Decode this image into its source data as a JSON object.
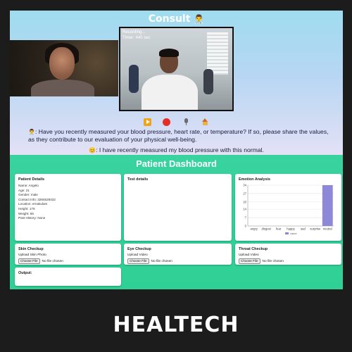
{
  "consult": {
    "title": "Consult",
    "title_emoji": "👨‍⚕️",
    "recording_label": "Recording...",
    "timer_label": "Timer: 440 sec",
    "controls": [
      {
        "name": "play-icon"
      },
      {
        "name": "record-icon"
      },
      {
        "name": "mic-icon"
      },
      {
        "name": "home-icon"
      }
    ],
    "question_emoji": "👨‍⚕️",
    "question_text": ": Have you recently measured your blood pressure, heart rate, or temperature? If so, please share the values, as they contribute to our evaluation of your physical well-being.",
    "answer_emoji": "😊",
    "answer_text": ": I have recently measured my blood pressure with this normal."
  },
  "dashboard": {
    "title": "Patient Dashboard",
    "patient_details": {
      "title": "Patient Details",
      "lines": [
        "Name: Angelo",
        "Age: 21",
        "Gender: male",
        "Contact Info: 3284628432",
        "Location: ernakulam",
        "Height: 179",
        "Weight: 65",
        "Past History: None"
      ]
    },
    "test_details": {
      "title": "Test details"
    },
    "emotion": {
      "title": "Emotion Analysis"
    },
    "skin": {
      "title": "Skin Checkup",
      "upload_label": "Upload Skin Photo",
      "button": "Choose File",
      "status": "No file chosen"
    },
    "eye": {
      "title": "Eye Checkup",
      "upload_label": "Upload Video",
      "button": "Choose File",
      "status": "No file chosen"
    },
    "throat": {
      "title": "Throat Checkup",
      "upload_label": "Upload Video",
      "button": "Choose File",
      "status": "No file chosen"
    },
    "output": {
      "title": "Output:"
    }
  },
  "footer": {
    "title": "HEALTECH"
  },
  "chart_data": {
    "type": "bar",
    "categories": [
      "angry",
      "disgust",
      "fear",
      "happy",
      "sad",
      "surprise",
      "neutral"
    ],
    "series": [
      {
        "name": "value",
        "values": [
          0,
          0,
          0,
          0,
          0,
          0,
          34
        ]
      }
    ],
    "yticks": [
      0,
      7,
      14,
      20,
      27,
      34
    ],
    "ylim": [
      0,
      34
    ],
    "grid": true,
    "legend": "bottom",
    "colors": {
      "bar": "#8e88d8"
    }
  }
}
